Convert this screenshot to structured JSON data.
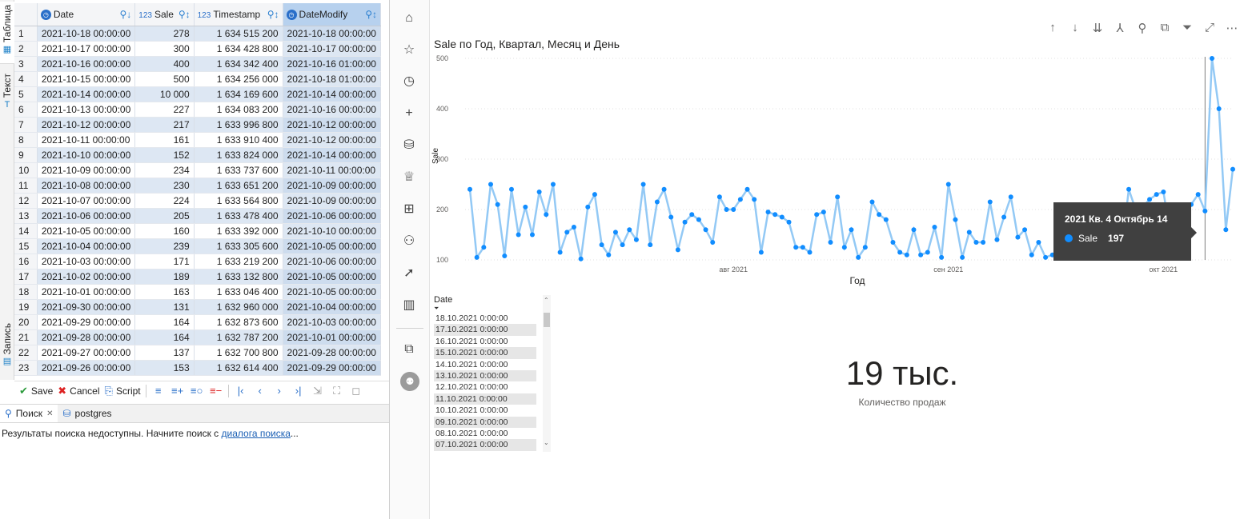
{
  "dbeaver": {
    "vtabs": {
      "table": "Таблица",
      "text": "Текст",
      "record": "Запись"
    },
    "columns": [
      {
        "type": "",
        "name": "Date"
      },
      {
        "type": "123",
        "name": "Sale"
      },
      {
        "type": "123",
        "name": "Timestamp"
      },
      {
        "type": "",
        "name": "DateModify"
      }
    ],
    "rows": [
      [
        "1",
        "2021-10-18 00:00:00",
        "278",
        "1 634 515 200",
        "2021-10-18 00:00:00"
      ],
      [
        "2",
        "2021-10-17 00:00:00",
        "300",
        "1 634 428 800",
        "2021-10-17 00:00:00"
      ],
      [
        "3",
        "2021-10-16 00:00:00",
        "400",
        "1 634 342 400",
        "2021-10-16 01:00:00"
      ],
      [
        "4",
        "2021-10-15 00:00:00",
        "500",
        "1 634 256 000",
        "2021-10-18 01:00:00"
      ],
      [
        "5",
        "2021-10-14 00:00:00",
        "10 000",
        "1 634 169 600",
        "2021-10-14 00:00:00"
      ],
      [
        "6",
        "2021-10-13 00:00:00",
        "227",
        "1 634 083 200",
        "2021-10-16 00:00:00"
      ],
      [
        "7",
        "2021-10-12 00:00:00",
        "217",
        "1 633 996 800",
        "2021-10-12 00:00:00"
      ],
      [
        "8",
        "2021-10-11 00:00:00",
        "161",
        "1 633 910 400",
        "2021-10-12 00:00:00"
      ],
      [
        "9",
        "2021-10-10 00:00:00",
        "152",
        "1 633 824 000",
        "2021-10-14 00:00:00"
      ],
      [
        "10",
        "2021-10-09 00:00:00",
        "234",
        "1 633 737 600",
        "2021-10-11 00:00:00"
      ],
      [
        "11",
        "2021-10-08 00:00:00",
        "230",
        "1 633 651 200",
        "2021-10-09 00:00:00"
      ],
      [
        "12",
        "2021-10-07 00:00:00",
        "224",
        "1 633 564 800",
        "2021-10-09 00:00:00"
      ],
      [
        "13",
        "2021-10-06 00:00:00",
        "205",
        "1 633 478 400",
        "2021-10-06 00:00:00"
      ],
      [
        "14",
        "2021-10-05 00:00:00",
        "160",
        "1 633 392 000",
        "2021-10-10 00:00:00"
      ],
      [
        "15",
        "2021-10-04 00:00:00",
        "239",
        "1 633 305 600",
        "2021-10-05 00:00:00"
      ],
      [
        "16",
        "2021-10-03 00:00:00",
        "171",
        "1 633 219 200",
        "2021-10-06 00:00:00"
      ],
      [
        "17",
        "2021-10-02 00:00:00",
        "189",
        "1 633 132 800",
        "2021-10-05 00:00:00"
      ],
      [
        "18",
        "2021-10-01 00:00:00",
        "163",
        "1 633 046 400",
        "2021-10-05 00:00:00"
      ],
      [
        "19",
        "2021-09-30 00:00:00",
        "131",
        "1 632 960 000",
        "2021-10-04 00:00:00"
      ],
      [
        "20",
        "2021-09-29 00:00:00",
        "164",
        "1 632 873 600",
        "2021-10-03 00:00:00"
      ],
      [
        "21",
        "2021-09-28 00:00:00",
        "164",
        "1 632 787 200",
        "2021-10-01 00:00:00"
      ],
      [
        "22",
        "2021-09-27 00:00:00",
        "137",
        "1 632 700 800",
        "2021-09-28 00:00:00"
      ],
      [
        "23",
        "2021-09-26 00:00:00",
        "153",
        "1 632 614 400",
        "2021-09-29 00:00:00"
      ]
    ],
    "toolbar": {
      "save": "Save",
      "cancel": "Cancel",
      "script": "Script"
    },
    "bottom_tabs": {
      "search": "Поиск",
      "connection": "postgres"
    },
    "search_msg": {
      "before": "Результаты поиска недоступны. Начните поиск с ",
      "link": "диалога поиска",
      "after": "..."
    }
  },
  "powerbi": {
    "nav_icons": [
      "home-icon",
      "favorites-icon",
      "recent-icon",
      "create-icon",
      "datasets-icon",
      "goals-icon",
      "apps-icon",
      "shared-icon",
      "deployment-icon",
      "learn-icon",
      "workspaces-icon"
    ],
    "visual_tools": [
      "drill-up-icon",
      "drill-down-icon",
      "expand-all-icon",
      "expand-next-icon",
      "pin-icon",
      "copy-icon",
      "filter-icon",
      "focus-icon",
      "more-icon"
    ],
    "chart_title": "Sale по Год, Квартал, Месяц и День",
    "tooltip": {
      "title": "2021 Кв. 4 Октябрь 14",
      "series": "Sale",
      "value": "197"
    },
    "slicer": {
      "title": "Date",
      "items": [
        "18.10.2021 0:00:00",
        "17.10.2021 0:00:00",
        "16.10.2021 0:00:00",
        "15.10.2021 0:00:00",
        "14.10.2021 0:00:00",
        "13.10.2021 0:00:00",
        "12.10.2021 0:00:00",
        "11.10.2021 0:00:00",
        "10.10.2021 0:00:00",
        "09.10.2021 0:00:00",
        "08.10.2021 0:00:00",
        "07.10.2021 0:00:00"
      ]
    },
    "kpi": {
      "value": "19 тыс.",
      "label": "Количество продаж"
    },
    "line_color": "#118dff",
    "line_color_light": "#93c9f5"
  },
  "chart_data": {
    "type": "line",
    "xlabel": "Год",
    "ylabel": "Sale",
    "x_tick_labels": [
      "авг 2021",
      "сен 2021",
      "окт 2021"
    ],
    "x_tick_positions": [
      38,
      69,
      100
    ],
    "y_ticks": [
      100,
      200,
      300,
      400,
      500
    ],
    "ylim": [
      100,
      500
    ],
    "series": [
      {
        "values": [
          240,
          105,
          125,
          250,
          210,
          108,
          240,
          150,
          205,
          150,
          235,
          190,
          250,
          115,
          155,
          165,
          102,
          205,
          230,
          130,
          110,
          155,
          130,
          160,
          140,
          250,
          130,
          215,
          240,
          185,
          120,
          175,
          190,
          180,
          160,
          135,
          225,
          200,
          200,
          220,
          240,
          220,
          115,
          195,
          190,
          185,
          175,
          125,
          125,
          115,
          190,
          195,
          135,
          225,
          125,
          160,
          105,
          125,
          215,
          190,
          180,
          135,
          115,
          110,
          160,
          110,
          115,
          165,
          105,
          250,
          180,
          105,
          155,
          135,
          135,
          215,
          140,
          185,
          225,
          145,
          160,
          110,
          135,
          105,
          110,
          105,
          120,
          135,
          130,
          200,
          115,
          130,
          130,
          115,
          120,
          240,
          200,
          205,
          220,
          230,
          235,
          150,
          160,
          195,
          210,
          230,
          197,
          500,
          400,
          160,
          280
        ]
      }
    ],
    "highlight_index": 106
  }
}
